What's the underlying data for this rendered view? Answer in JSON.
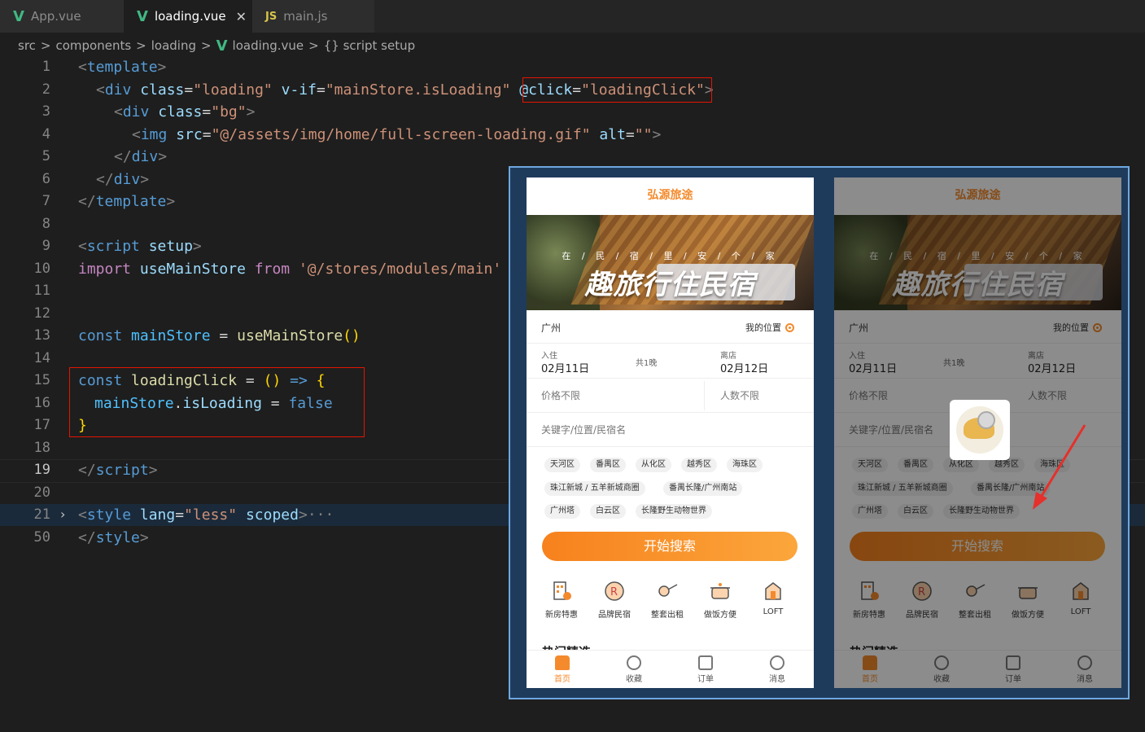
{
  "tabs": [
    {
      "icon": "V",
      "label": "App.vue",
      "active": false
    },
    {
      "icon": "V",
      "label": "loading.vue",
      "active": true
    },
    {
      "icon": "JS",
      "label": "main.js",
      "active": false
    }
  ],
  "tab_close": "✕",
  "breadcrumb": {
    "p1": "src",
    "p2": "components",
    "p3": "loading",
    "p4": "loading.vue",
    "p5": "{} script setup",
    "sep": ">"
  },
  "line_numbers": [
    "1",
    "2",
    "3",
    "4",
    "5",
    "6",
    "7",
    "8",
    "9",
    "10",
    "11",
    "12",
    "13",
    "14",
    "15",
    "16",
    "17",
    "18",
    "19",
    "20",
    "21",
    "50"
  ],
  "current_line": "19",
  "code": {
    "l1": {
      "open": "<",
      "tag": "template",
      "close": ">"
    },
    "l2": {
      "lt": "<",
      "tag": "div",
      "a1": "class",
      "eq1": "=",
      "v1": "\"loading\"",
      "a2": "v-if",
      "eq2": "=",
      "v2": "\"mainStore.isLoading\"",
      "a3": "@click",
      "eq3": "=",
      "v3": "\"loadingClick\"",
      "gt": ">"
    },
    "l3": {
      "lt": "<",
      "tag": "div",
      "a1": "class",
      "eq1": "=",
      "v1": "\"bg\"",
      "gt": ">"
    },
    "l4": {
      "lt": "<",
      "tag": "img",
      "a1": "src",
      "eq1": "=",
      "v1": "\"@/assets/img/home/full-screen-loading.gif\"",
      "a2": "alt",
      "eq2": "=",
      "v2": "\"\"",
      "gt": ">"
    },
    "l5": {
      "lt": "</",
      "tag": "div",
      "gt": ">"
    },
    "l6": {
      "lt": "</",
      "tag": "div",
      "gt": ">"
    },
    "l7": {
      "lt": "</",
      "tag": "template",
      "gt": ">"
    },
    "l9": {
      "lt": "<",
      "tag": "script",
      "attr": "setup",
      "gt": ">"
    },
    "l10": {
      "kw": "import",
      "name": "useMainStore",
      "from": "from",
      "path": "'@/stores/modules/main'"
    },
    "l13": {
      "kw": "const",
      "name": "mainStore",
      "eq": "=",
      "fn": "useMainStore",
      "paren": "()"
    },
    "l15": {
      "kw": "const",
      "name": "loadingClick",
      "eq": "=",
      "paren": "()",
      "arrow": "=>",
      "brace": "{"
    },
    "l16": {
      "obj": "mainStore",
      "dot": ".",
      "prop": "isLoading",
      "eq": "=",
      "val": "false"
    },
    "l17": {
      "brace": "}"
    },
    "l19": {
      "lt": "</",
      "tag": "script",
      "gt": ">"
    },
    "l21": {
      "lt": "<",
      "tag": "style",
      "a1": "lang",
      "eq1": "=",
      "v1": "\"less\"",
      "a2": "scoped",
      "gt": ">",
      "ellipsis": "···"
    },
    "l50": {
      "lt": "</",
      "tag": "style",
      "gt": ">"
    }
  },
  "fold_icon": "›",
  "app": {
    "brand": "弘源旅途",
    "banner_sub": "在 / 民 / 宿 / 里 / 安 / 个 / 家",
    "banner_title": "趣旅行住民宿",
    "city": "广州",
    "my_position": "我的位置",
    "checkin_label": "入住",
    "checkin_date": "02月11日",
    "nights": "共1晚",
    "checkout_label": "离店",
    "checkout_date": "02月12日",
    "price": "价格不限",
    "people": "人数不限",
    "keyword": "关键字/位置/民宿名",
    "tags_row1": [
      "天河区",
      "番禺区",
      "从化区",
      "越秀区",
      "海珠区"
    ],
    "tags_row2": [
      "珠江新城 / 五羊新城商圈",
      "番禺长隆/广州南站"
    ],
    "tags_row3": [
      "广州塔",
      "白云区",
      "长隆野生动物世界"
    ],
    "search_button": "开始搜索",
    "categories": [
      "新房特惠",
      "品牌民宿",
      "整套出租",
      "做饭方便",
      "LOFT"
    ],
    "section_peek": "热门精选",
    "nav": [
      "首页",
      "收藏",
      "订单",
      "消息"
    ],
    "accent": "#f48a2c"
  }
}
